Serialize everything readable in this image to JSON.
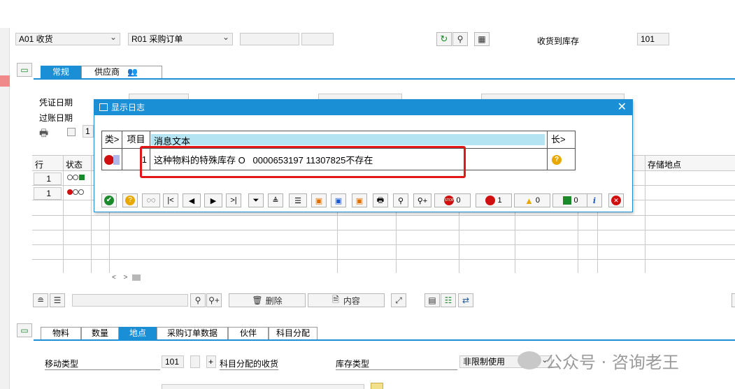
{
  "header": {
    "movement_type": "A01 收货",
    "reference_doc": "R01 采购订单",
    "goods_receipt_label": "收货到库存",
    "goods_receipt_value": "101"
  },
  "top_tabs": [
    {
      "label": "常规",
      "active": true
    },
    {
      "label": "供应商",
      "active": false
    }
  ],
  "general": {
    "doc_date_label": "凭证日期",
    "post_date_label": "过账日期",
    "print_count": "1"
  },
  "item_table": {
    "columns": [
      "行",
      "状态"
    ],
    "right_column": "存储地点",
    "rows": [
      {
        "line": "1",
        "status": "warn-ok"
      },
      {
        "line": "1",
        "status": "error"
      }
    ]
  },
  "bottom_toolbar": {
    "delete_label": "删除",
    "content_label": "内容"
  },
  "detail_tabs": [
    {
      "label": "物料",
      "active": false
    },
    {
      "label": "数量",
      "active": false
    },
    {
      "label": "地点",
      "active": true
    },
    {
      "label": "采购订单数据",
      "active": false
    },
    {
      "label": "伙伴",
      "active": false
    },
    {
      "label": "科目分配",
      "active": false
    }
  ],
  "detail": {
    "movement_type_label": "移动类型",
    "movement_type_value": "101",
    "acct_assign_gr_label": "科目分配的收货",
    "stock_type_label": "库存类型",
    "stock_type_value": "非限制使用"
  },
  "dialog": {
    "title": "显示日志",
    "col_type": "类>",
    "col_item": "项目",
    "col_message": "消息文本",
    "col_long": "长>",
    "message": {
      "item": "1",
      "text": "这种物料的特殊库存 O   0000653197 11307825不存在"
    },
    "counters": {
      "stop": "0",
      "error": "1",
      "warning": "0",
      "success": "0"
    }
  },
  "watermark": "公众号 · 咨询老王",
  "colors": {
    "accent": "#1a8fd6",
    "error": "#d01010",
    "warning": "#e8a800",
    "success": "#1a8a2a",
    "highlight_box": "#e01818"
  }
}
